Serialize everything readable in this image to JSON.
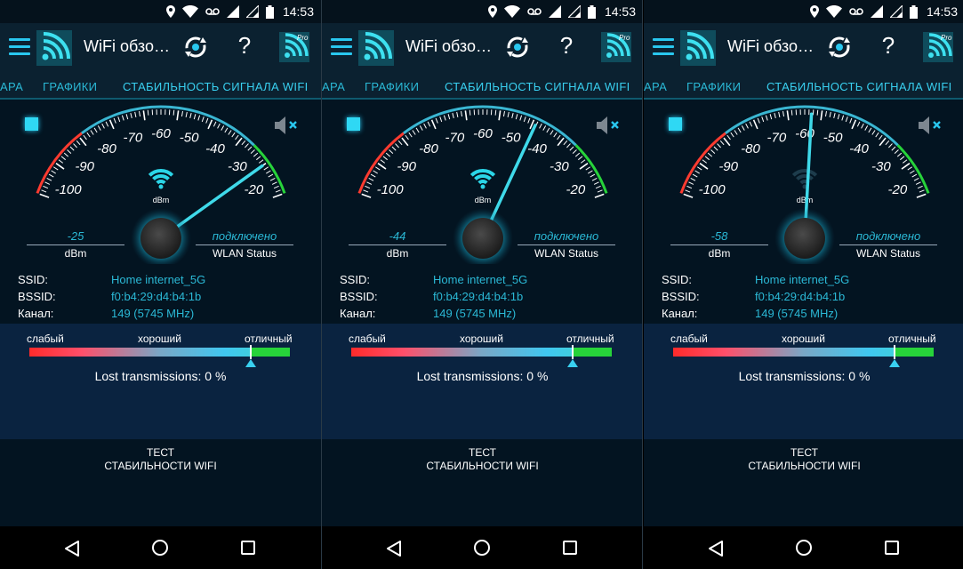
{
  "status_bar": {
    "time": "14:53"
  },
  "app": {
    "title": "WiFi обзо…",
    "pro_badge": "Pro"
  },
  "tabs": [
    {
      "label": "АРА"
    },
    {
      "label": "ГРАФИКИ"
    },
    {
      "label": "СТАБИЛЬНОСТЬ СИГНАЛА WIFI",
      "active": true
    }
  ],
  "gauge": {
    "scale_labels": [
      "-100",
      "-90",
      "-80",
      "-70",
      "-60",
      "-50",
      "-40",
      "-30",
      "-20"
    ],
    "unit_center": "dBm",
    "range": [
      -105,
      -15
    ]
  },
  "labels": {
    "dbm": "dBm",
    "wlan_status": "WLAN Status",
    "ssid": "SSID:",
    "bssid": "BSSID:",
    "channel": "Канал:"
  },
  "quality": {
    "weak": "слабый",
    "good": "хороший",
    "excellent": "отличный",
    "marker_fraction": 0.85
  },
  "test_button": {
    "label": "ТЕСТ\nСТАБИЛЬНОСТИ WIFI"
  },
  "panels": [
    {
      "dbm_value": "-25",
      "needle_dbm": -25,
      "wifi_icon_color": "#2bd6e8",
      "status": "подключено",
      "ssid": "Home internet_5G",
      "bssid": "f0:b4:29:d4:b4:1b",
      "channel": "149 (5745 MHz)",
      "lost": "Lost transmissions: 0 %"
    },
    {
      "dbm_value": "-44",
      "needle_dbm": -44,
      "wifi_icon_color": "#2bd6e8",
      "status": "подключено",
      "ssid": "Home internet_5G",
      "bssid": "f0:b4:29:d4:b4:1b",
      "channel": "149 (5745 MHz)",
      "lost": "Lost transmissions: 0 %"
    },
    {
      "dbm_value": "-58",
      "needle_dbm": -58,
      "wifi_icon_color": "#1d3c4c",
      "status": "подключено",
      "ssid": "Home internet_5G",
      "bssid": "f0:b4:29:d4:b4:1b",
      "channel": "149 (5745 MHz)",
      "lost": "Lost transmissions: 0 %"
    }
  ],
  "colors": {
    "accent": "#39d0f0",
    "background": "#031421",
    "appbar": "#0b2130",
    "quality_bg": "#0a2340",
    "gauge_red": "#ff3b30",
    "gauge_green": "#27d33a"
  }
}
